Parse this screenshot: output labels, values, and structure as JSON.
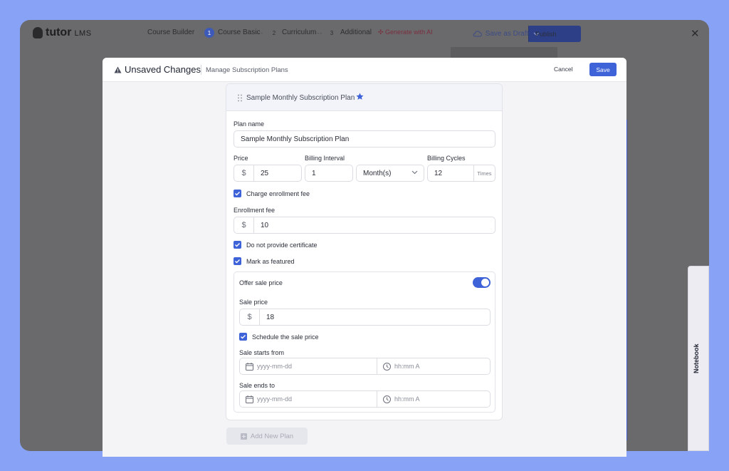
{
  "app": {
    "logo_text": "tutor",
    "logo_suffix": "LMS",
    "course_builder": "Course Builder",
    "steps": [
      {
        "num": "1",
        "label": "Course Basic"
      },
      {
        "num": "2",
        "label": "Curriculum"
      },
      {
        "num": "3",
        "label": "Additional"
      }
    ],
    "generate_ai": "Generate with AI",
    "save_draft": "Save as Draft",
    "publish": "Publish"
  },
  "modal": {
    "title": "Unsaved Changes",
    "subtitle": "Manage Subscription Plans",
    "cancel_label": "Cancel",
    "save_label": "Save"
  },
  "plan": {
    "header_title": "Sample Monthly Subscription Plan",
    "plan_name_label": "Plan name",
    "plan_name_value": "Sample Monthly Subscription Plan",
    "price_label": "Price",
    "currency": "$",
    "price_value": "25",
    "billing_interval_label": "Billing Interval",
    "billing_interval_value": "1",
    "billing_interval_unit": "Month(s)",
    "billing_cycles_label": "Billing Cycles",
    "billing_cycles_value": "12",
    "billing_cycles_suffix": "Times",
    "charge_enrollment_label": "Charge enrollment fee",
    "enrollment_fee_label": "Enrollment fee",
    "enrollment_fee_value": "10",
    "no_certificate_label": "Do not provide certificate",
    "mark_featured_label": "Mark as featured",
    "offer_sale_label": "Offer sale price",
    "sale_price_label": "Sale price",
    "sale_price_value": "18",
    "schedule_sale_label": "Schedule the sale price",
    "sale_starts_label": "Sale starts from",
    "sale_ends_label": "Sale ends to",
    "date_placeholder": "yyyy-mm-dd",
    "time_placeholder": "hh:mm A"
  },
  "add_plan_label": "Add New Plan",
  "notebook_label": "Notebook",
  "colors": {
    "accent": "#3e62d8",
    "background": "#88a3f6"
  }
}
